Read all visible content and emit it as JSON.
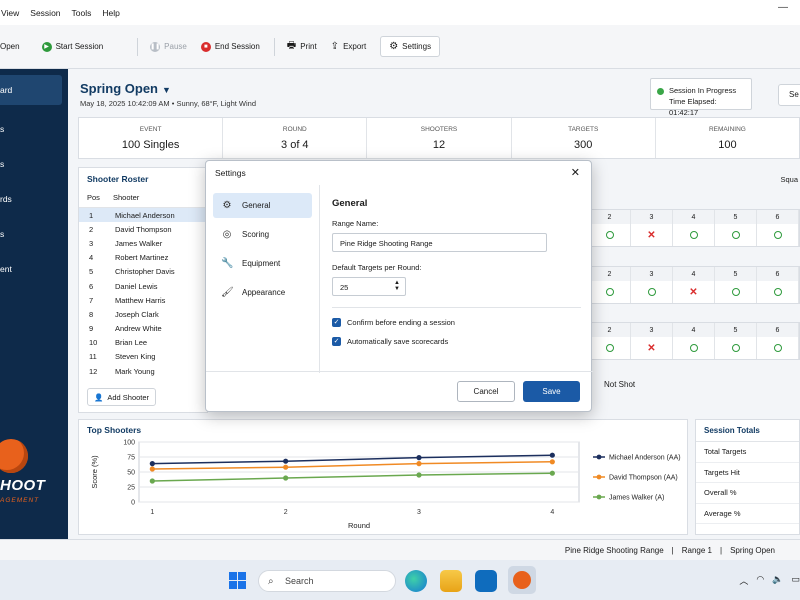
{
  "menu": [
    "View",
    "Session",
    "Tools",
    "Help"
  ],
  "toolbar": {
    "open": "Open",
    "start": "Start Session",
    "pause": "Pause",
    "end": "End Session",
    "print": "Print",
    "export": "Export",
    "settings": "Settings"
  },
  "sidebar": {
    "items": [
      "ard",
      "s",
      "s",
      "rds",
      "s",
      "ent"
    ],
    "logo_main": "HOOT",
    "logo_sub": "AGEMENT"
  },
  "header": {
    "title": "Spring Open",
    "subtitle": "May 18, 2025   10:42:09 AM   •   Sunny, 68°F, Light Wind",
    "status_line1": "Session In Progress",
    "status_line2": "Time Elapsed: 01:42:17",
    "right_button": "Se"
  },
  "stats": [
    {
      "label": "EVENT",
      "value": "100 Singles"
    },
    {
      "label": "ROUND",
      "value": "3 of 4"
    },
    {
      "label": "SHOOTERS",
      "value": "12"
    },
    {
      "label": "TARGETS",
      "value": "300"
    },
    {
      "label": "REMAINING",
      "value": "100"
    }
  ],
  "roster": {
    "title": "Shooter Roster",
    "col_pos": "Pos",
    "col_shooter": "Shooter",
    "rows": [
      {
        "pos": "1",
        "name": "Michael Anderson"
      },
      {
        "pos": "2",
        "name": "David Thompson"
      },
      {
        "pos": "3",
        "name": "James Walker"
      },
      {
        "pos": "4",
        "name": "Robert Martinez"
      },
      {
        "pos": "5",
        "name": "Christopher Davis"
      },
      {
        "pos": "6",
        "name": "Daniel Lewis"
      },
      {
        "pos": "7",
        "name": "Matthew Harris"
      },
      {
        "pos": "8",
        "name": "Joseph Clark"
      },
      {
        "pos": "9",
        "name": "Andrew White"
      },
      {
        "pos": "10",
        "name": "Brian Lee"
      },
      {
        "pos": "11",
        "name": "Steven King"
      },
      {
        "pos": "12",
        "name": "Mark Young"
      }
    ],
    "add_button": "Add Shooter"
  },
  "grid": {
    "squad_label": "Squa",
    "headers": [
      "2",
      "3",
      "4",
      "5",
      "6"
    ],
    "blocks": [
      [
        "hit",
        "miss",
        "hit",
        "hit",
        "hit"
      ],
      [
        "hit",
        "hit",
        "miss",
        "hit",
        "hit"
      ],
      [
        "hit",
        "miss",
        "hit",
        "hit",
        "hit"
      ]
    ],
    "not_shot": "Not Shot"
  },
  "top_shooters": {
    "title": "Top Shooters"
  },
  "chart_data": {
    "type": "line",
    "title": "Top Shooters",
    "xlabel": "Round",
    "ylabel": "Score (%)",
    "x": [
      1,
      2,
      3,
      4
    ],
    "ylim": [
      0,
      100
    ],
    "yticks": [
      0,
      25,
      50,
      75,
      100
    ],
    "series": [
      {
        "name": "Michael Anderson (AA)",
        "color": "#1c2f5e",
        "values": [
          64,
          68,
          74,
          78
        ]
      },
      {
        "name": "David Thompson (AA)",
        "color": "#f08a24",
        "values": [
          55,
          58,
          64,
          67
        ]
      },
      {
        "name": "James Walker (A)",
        "color": "#6aa84f",
        "values": [
          35,
          40,
          45,
          48
        ]
      }
    ],
    "legend": "right",
    "grid": true
  },
  "totals": {
    "title": "Session Totals",
    "rows": [
      "Total Targets",
      "Targets Hit",
      "Overall %",
      "Average %"
    ]
  },
  "statusbar": [
    "Pine Ridge Shooting Range",
    "|",
    "Range 1",
    "|",
    "Spring Open"
  ],
  "taskbar": {
    "search": "Search"
  },
  "modal": {
    "title": "Settings",
    "nav": [
      {
        "label": "General",
        "icon": "gear-icon"
      },
      {
        "label": "Scoring",
        "icon": "target-icon"
      },
      {
        "label": "Equipment",
        "icon": "wrench-icon"
      },
      {
        "label": "Appearance",
        "icon": "brush-icon"
      }
    ],
    "section_title": "General",
    "range_name_label": "Range Name:",
    "range_name_value": "Pine Ridge Shooting Range",
    "default_targets_label": "Default Targets per Round:",
    "default_targets_value": "25",
    "confirm_label": "Confirm before ending a session",
    "autosave_label": "Automatically save scorecards",
    "cancel": "Cancel",
    "save": "Save"
  }
}
